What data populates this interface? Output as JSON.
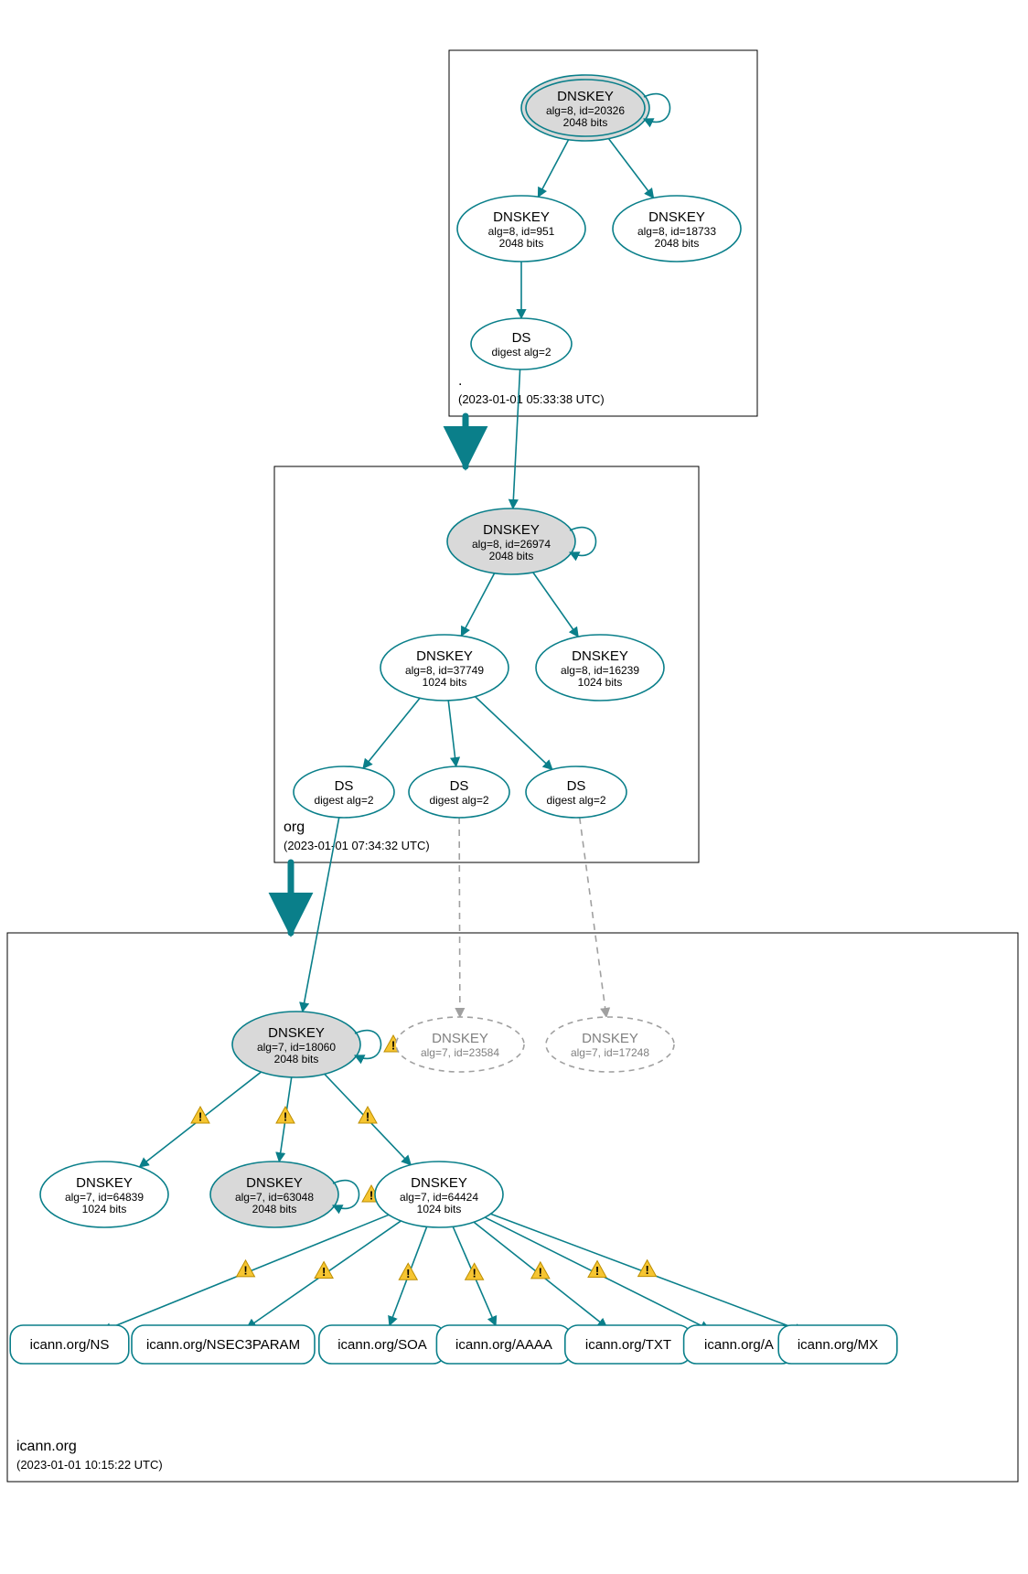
{
  "chart_data": {
    "type": "dnssec-authentication-graph",
    "zones": [
      {
        "id": "root",
        "name": ".",
        "timestamp": "(2023-01-01 05:33:38 UTC)",
        "nodes": [
          {
            "id": "root_ksk",
            "kind": "DNSKEY",
            "l1": "alg=8, id=20326",
            "l2": "2048 bits",
            "style": "ksk_double",
            "fill": "#d9d9d9",
            "self_loop": true
          },
          {
            "id": "root_zsk",
            "kind": "DNSKEY",
            "l1": "alg=8, id=951",
            "l2": "2048 bits",
            "style": "plain"
          },
          {
            "id": "root_zsk2",
            "kind": "DNSKEY",
            "l1": "alg=8, id=18733",
            "l2": "2048 bits",
            "style": "plain"
          },
          {
            "id": "root_ds",
            "kind": "DS",
            "l1": "digest alg=2",
            "l2": "",
            "style": "plain"
          }
        ]
      },
      {
        "id": "org",
        "name": "org",
        "timestamp": "(2023-01-01 07:34:32 UTC)",
        "nodes": [
          {
            "id": "org_ksk",
            "kind": "DNSKEY",
            "l1": "alg=8, id=26974",
            "l2": "2048 bits",
            "style": "ksk_single",
            "fill": "#d9d9d9",
            "self_loop": true
          },
          {
            "id": "org_zsk",
            "kind": "DNSKEY",
            "l1": "alg=8, id=37749",
            "l2": "1024 bits",
            "style": "plain"
          },
          {
            "id": "org_zsk2",
            "kind": "DNSKEY",
            "l1": "alg=8, id=16239",
            "l2": "1024 bits",
            "style": "plain"
          },
          {
            "id": "org_ds1",
            "kind": "DS",
            "l1": "digest alg=2",
            "l2": "",
            "style": "plain"
          },
          {
            "id": "org_ds2",
            "kind": "DS",
            "l1": "digest alg=2",
            "l2": "",
            "style": "plain",
            "dashed_exit": true
          },
          {
            "id": "org_ds3",
            "kind": "DS",
            "l1": "digest alg=2",
            "l2": "",
            "style": "plain",
            "dashed_exit": true
          }
        ]
      },
      {
        "id": "icann",
        "name": "icann.org",
        "timestamp": "(2023-01-01 10:15:22 UTC)",
        "nodes": [
          {
            "id": "ic_ksk",
            "kind": "DNSKEY",
            "l1": "alg=7, id=18060",
            "l2": "2048 bits",
            "style": "ksk_single",
            "fill": "#d9d9d9",
            "self_loop": true,
            "warn": true
          },
          {
            "id": "ic_ghost1",
            "kind": "DNSKEY",
            "l1": "alg=7, id=23584",
            "l2": "",
            "style": "ghost"
          },
          {
            "id": "ic_ghost2",
            "kind": "DNSKEY",
            "l1": "alg=7, id=17248",
            "l2": "",
            "style": "ghost"
          },
          {
            "id": "ic_zsk1",
            "kind": "DNSKEY",
            "l1": "alg=7, id=64839",
            "l2": "1024 bits",
            "style": "plain"
          },
          {
            "id": "ic_zsk2",
            "kind": "DNSKEY",
            "l1": "alg=7, id=63048",
            "l2": "2048 bits",
            "style": "ksk_single",
            "fill": "#d9d9d9",
            "self_loop": true,
            "warn": true
          },
          {
            "id": "ic_zsk3",
            "kind": "DNSKEY",
            "l1": "alg=7, id=64424",
            "l2": "1024 bits",
            "style": "plain"
          }
        ],
        "rrsets": [
          {
            "id": "rr_ns",
            "label": "icann.org/NS"
          },
          {
            "id": "rr_nsec3",
            "label": "icann.org/NSEC3PARAM"
          },
          {
            "id": "rr_soa",
            "label": "icann.org/SOA"
          },
          {
            "id": "rr_aaaa",
            "label": "icann.org/AAAA"
          },
          {
            "id": "rr_txt",
            "label": "icann.org/TXT"
          },
          {
            "id": "rr_a",
            "label": "icann.org/A"
          },
          {
            "id": "rr_mx",
            "label": "icann.org/MX"
          }
        ]
      }
    ],
    "edges_solid": [
      [
        "root_ksk",
        "root_zsk"
      ],
      [
        "root_ksk",
        "root_zsk2"
      ],
      [
        "root_zsk",
        "root_ds"
      ],
      [
        "root_ds",
        "org_ksk"
      ],
      [
        "org_ksk",
        "org_zsk"
      ],
      [
        "org_ksk",
        "org_zsk2"
      ],
      [
        "org_zsk",
        "org_ds1"
      ],
      [
        "org_zsk",
        "org_ds2"
      ],
      [
        "org_zsk",
        "org_ds3"
      ],
      [
        "org_ds1",
        "ic_ksk"
      ],
      [
        "ic_ksk",
        "ic_zsk1",
        "warn"
      ],
      [
        "ic_ksk",
        "ic_zsk2",
        "warn"
      ],
      [
        "ic_ksk",
        "ic_zsk3",
        "warn"
      ],
      [
        "ic_zsk3",
        "rr_ns",
        "warn"
      ],
      [
        "ic_zsk3",
        "rr_nsec3",
        "warn"
      ],
      [
        "ic_zsk3",
        "rr_soa",
        "warn"
      ],
      [
        "ic_zsk3",
        "rr_aaaa",
        "warn"
      ],
      [
        "ic_zsk3",
        "rr_txt",
        "warn"
      ],
      [
        "ic_zsk3",
        "rr_a",
        "warn"
      ],
      [
        "ic_zsk3",
        "rr_mx",
        "warn"
      ]
    ],
    "edges_dashed": [
      [
        "org_ds2",
        "ic_ghost1"
      ],
      [
        "org_ds3",
        "ic_ghost2"
      ]
    ],
    "zone_delegations_thick": [
      [
        "root",
        "org"
      ],
      [
        "org",
        "icann"
      ]
    ]
  },
  "colors": {
    "teal": "#0a7f8a",
    "grey": "#a0a0a0",
    "node_fill": "#d9d9d9"
  }
}
